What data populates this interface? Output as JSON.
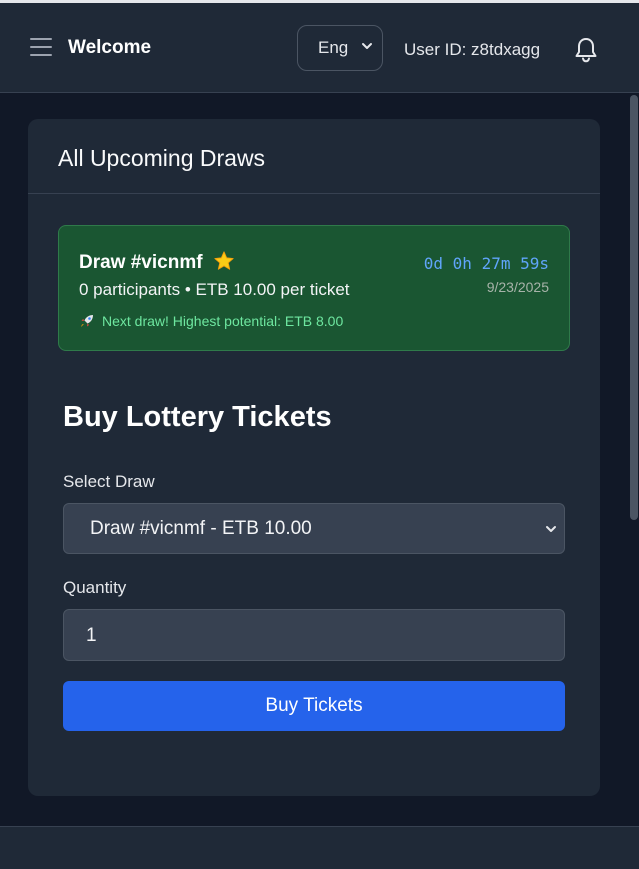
{
  "header": {
    "brand": "Welcome",
    "language": "Eng",
    "user_id": "User ID: z8tdxagg",
    "icons": {
      "menu": "hamburger-menu-icon",
      "notifications": "bell-icon",
      "dropdown": "chevron-down-icon"
    }
  },
  "upcoming": {
    "title": "All Upcoming Draws",
    "draws": [
      {
        "name": "Draw #vicnmf",
        "badge_icon": "star-icon",
        "meta": "0 participants • ETB 10.00 per ticket",
        "note": "Next draw! Highest potential: ETB 8.00",
        "note_icon": "rocket-icon",
        "countdown": "0d 0h 27m 59s",
        "date": "9/23/2025"
      }
    ]
  },
  "purchase": {
    "title": "Buy Lottery Tickets",
    "select_label": "Select Draw",
    "selected_draw": "Draw #vicnmf - ETB 10.00",
    "quantity_label": "Quantity",
    "quantity_value": "1",
    "buy_button": "Buy Tickets"
  },
  "colors": {
    "background": "#111827",
    "panel": "#1f2937",
    "draw_card": "#1a5632",
    "countdown": "#60a5fa",
    "note": "#6ee7a0",
    "primary_button": "#2563eb",
    "star": "#facc15"
  }
}
